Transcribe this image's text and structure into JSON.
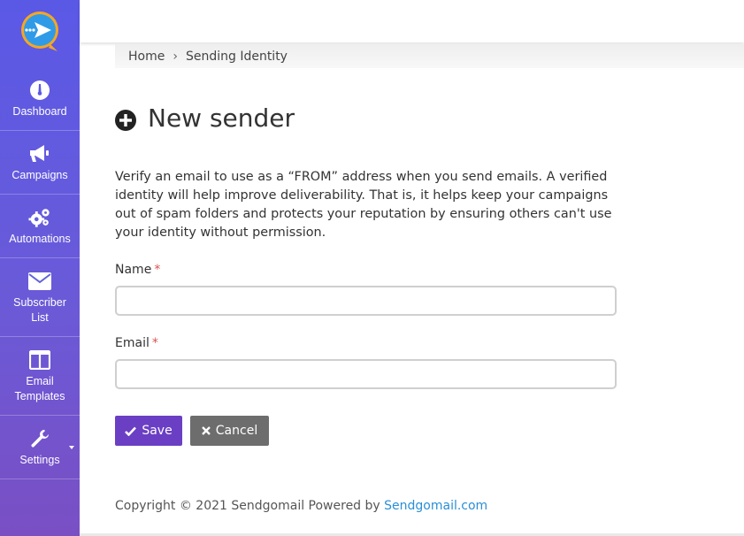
{
  "sidebar": {
    "logo_icon": "send-plane-icon",
    "items": [
      {
        "label": "Dashboard",
        "icon": "gauge-icon"
      },
      {
        "label": "Campaigns",
        "icon": "megaphone-icon"
      },
      {
        "label": "Automations",
        "icon": "gears-icon"
      },
      {
        "label": "Subscriber\nList",
        "icon": "envelope-icon"
      },
      {
        "label": "Email\nTemplates",
        "icon": "columns-icon"
      },
      {
        "label": "Settings",
        "icon": "wrench-icon"
      }
    ]
  },
  "breadcrumb": {
    "home": "Home",
    "separator": "›",
    "current": "Sending Identity"
  },
  "page": {
    "title": "New sender",
    "intro": "Verify an email to use as a “FROM” address when you send emails. A verified identity will help improve deliverability. That is, it helps keep your campaigns out of spam folders and protects your reputation by ensuring others can't use your identity without permission."
  },
  "form": {
    "name_label": "Name",
    "name_value": "",
    "email_label": "Email",
    "email_value": "",
    "required_mark": "*",
    "save_label": "Save",
    "cancel_label": "Cancel"
  },
  "footer": {
    "text": "Copyright © 2021 Sendgomail Powered by",
    "link_text": "Sendgomail.com"
  },
  "colors": {
    "sidebar_top": "#5a59e6",
    "sidebar_bottom": "#7a4fc4",
    "save_button": "#6b3fc4",
    "cancel_button": "#6d6d6d",
    "required": "#d9534f",
    "link": "#2a8fd6"
  }
}
